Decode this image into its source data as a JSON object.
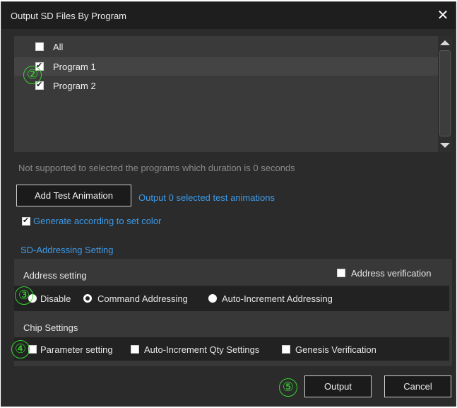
{
  "window": {
    "title": "Output SD Files By Program",
    "close_icon": "✕"
  },
  "program_list": {
    "items": [
      {
        "label": "All",
        "checked": false
      },
      {
        "label": "Program 1",
        "checked": true
      },
      {
        "label": "Program 2",
        "checked": true
      }
    ]
  },
  "hint_text": "Not supported to selected the programs which duration is 0 seconds",
  "add_test_animation_label": "Add Test Animation",
  "output_selected_text": "Output 0 selected test animations",
  "generate_color": {
    "label": "Generate according to set color",
    "checked": true
  },
  "sd_addressing": {
    "section_title": "SD-Addressing Setting",
    "address_setting_label": "Address setting",
    "address_verification": {
      "label": "Address verification",
      "checked": false
    },
    "modes": [
      {
        "label": "Disable",
        "selected": false
      },
      {
        "label": "Command Addressing",
        "selected": true
      },
      {
        "label": "Auto-Increment Addressing",
        "selected": false
      }
    ],
    "chip_settings_label": "Chip Settings",
    "chip_options": [
      {
        "label": "Parameter setting",
        "checked": false
      },
      {
        "label": "Auto-Increment Qty Settings",
        "checked": false
      },
      {
        "label": "Genesis Verification",
        "checked": false
      }
    ]
  },
  "footer": {
    "output_label": "Output",
    "cancel_label": "Cancel"
  },
  "annotations": [
    "②",
    "③",
    "④",
    "⑤"
  ],
  "colors": {
    "accent_link": "#3d9bea",
    "annotation_green": "#37d32f",
    "dialog_bg": "#2b2b2b"
  }
}
